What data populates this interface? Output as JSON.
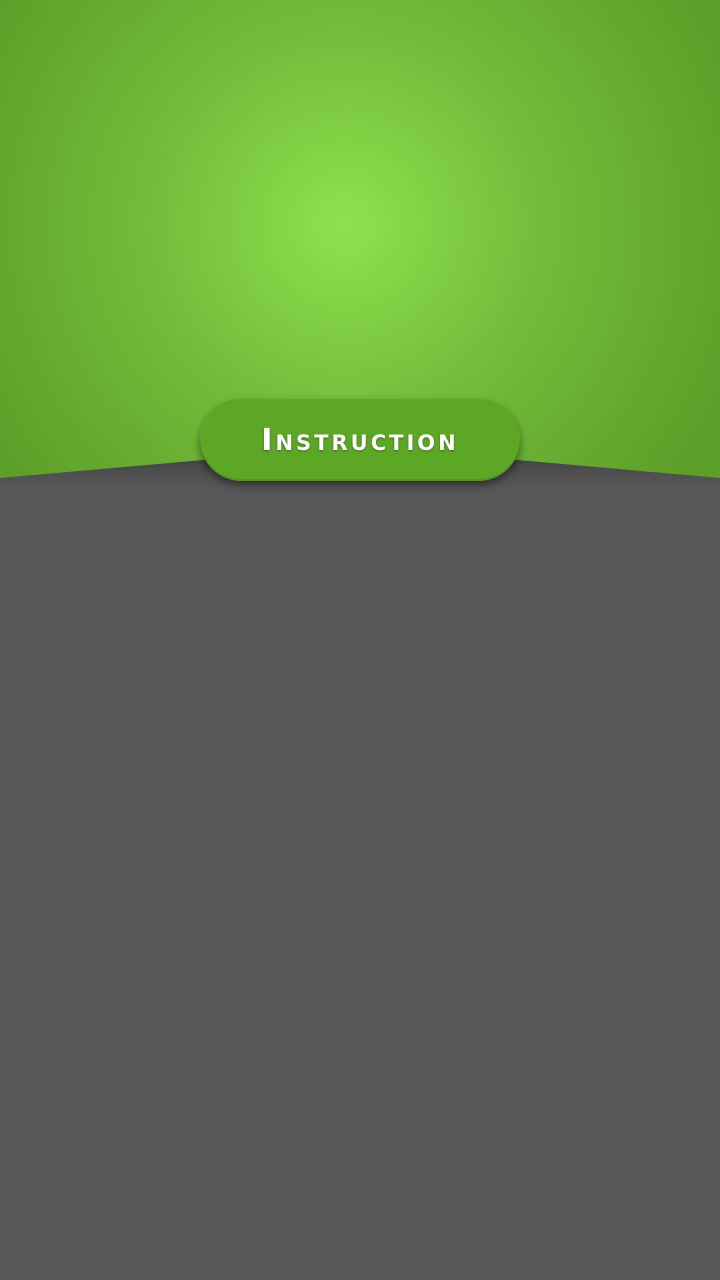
{
  "colors": {
    "header_center": "#8ee24e",
    "header_edge": "#5c9e28",
    "background": "#585858",
    "button": "#5da726",
    "button_text": "#ffffff"
  },
  "main": {
    "instruction_button_label": "Instruction"
  }
}
